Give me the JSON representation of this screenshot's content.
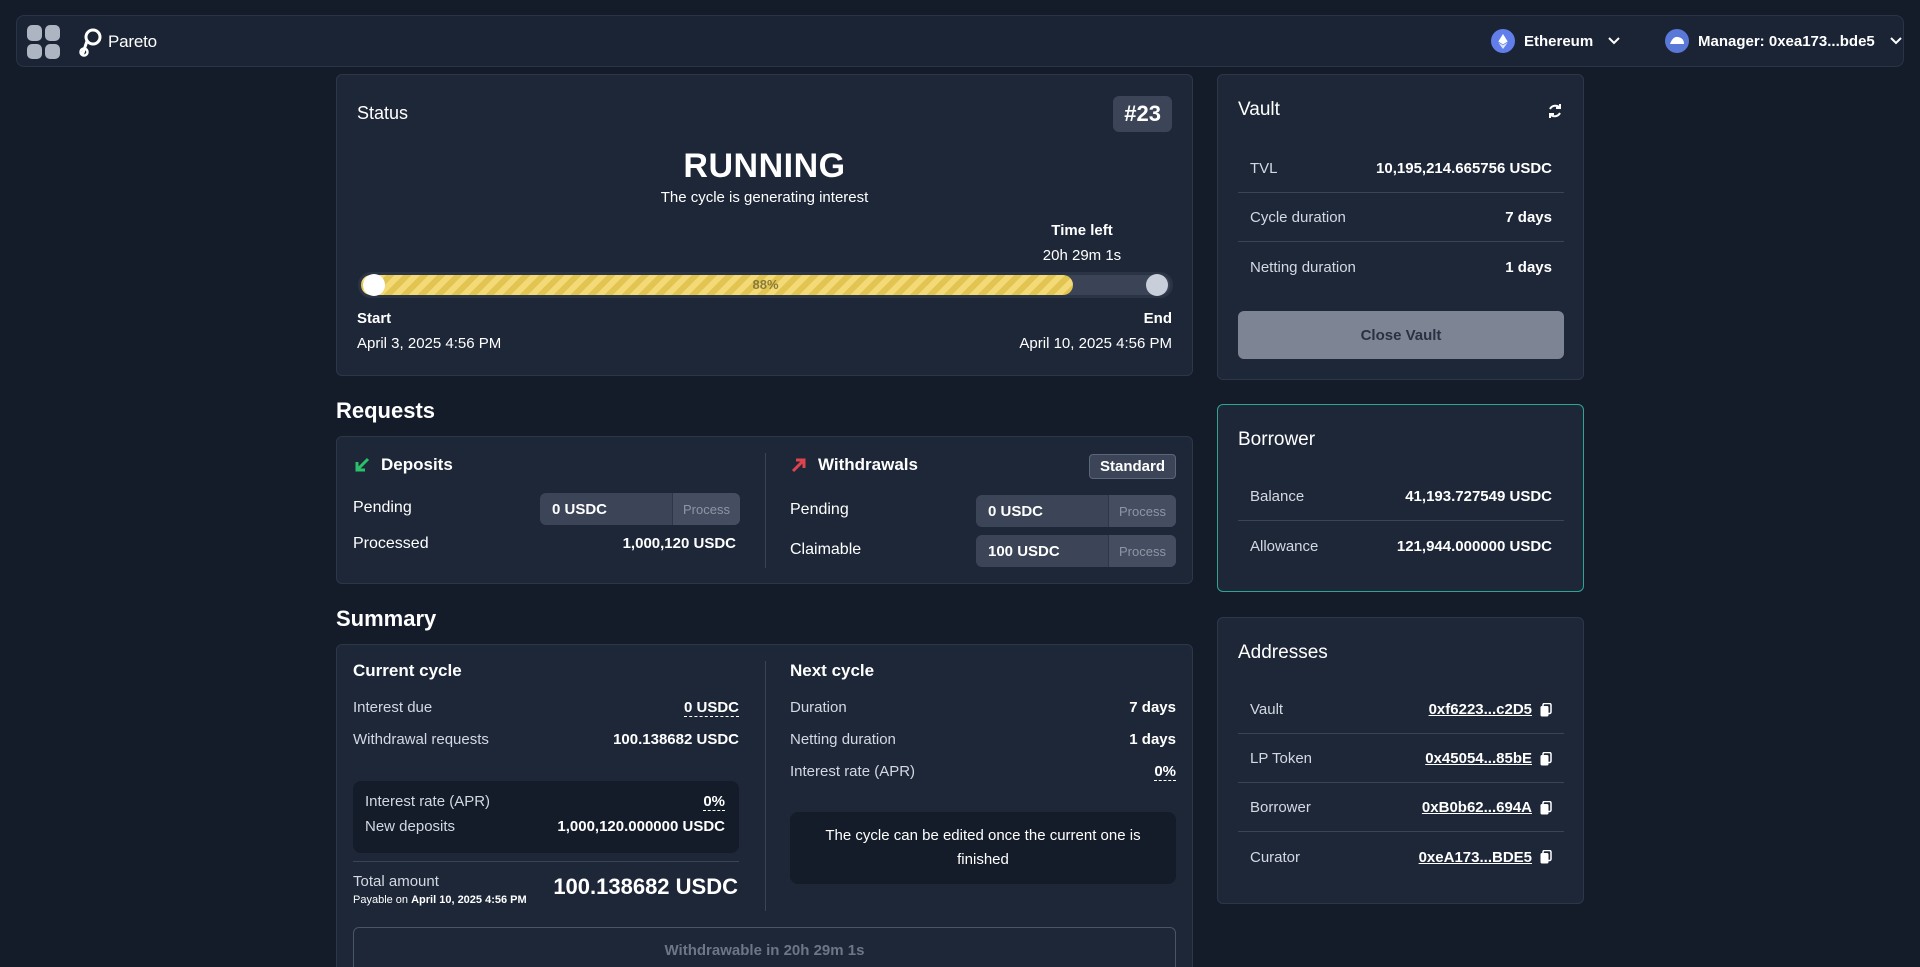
{
  "topbar": {
    "brand": "Pareto",
    "network": "Ethereum",
    "manager": "Manager: 0xea173...bde5"
  },
  "status": {
    "title": "Status",
    "cycle_number": "#23",
    "state": "RUNNING",
    "state_sub": "The cycle is generating interest",
    "time_left_label": "Time left",
    "time_left_value": "20h 29m 1s",
    "progress_percent": 88,
    "progress_label": "88%",
    "start_label": "Start",
    "start_value": "April 3, 2025 4:56 PM",
    "end_label": "End",
    "end_value": "April 10, 2025 4:56 PM"
  },
  "vault": {
    "title": "Vault",
    "rows": [
      {
        "label": "TVL",
        "value": "10,195,214.665756 USDC"
      },
      {
        "label": "Cycle duration",
        "value": "7 days"
      },
      {
        "label": "Netting duration",
        "value": "1 days"
      }
    ],
    "close_label": "Close Vault"
  },
  "borrower": {
    "title": "Borrower",
    "rows": [
      {
        "label": "Balance",
        "value": "41,193.727549 USDC"
      },
      {
        "label": "Allowance",
        "value": "121,944.000000 USDC"
      }
    ]
  },
  "addresses": {
    "title": "Addresses",
    "rows": [
      {
        "label": "Vault",
        "value": "0xf6223...c2D5"
      },
      {
        "label": "LP Token",
        "value": "0x45054...85bE"
      },
      {
        "label": "Borrower",
        "value": "0xB0b62...694A"
      },
      {
        "label": "Curator",
        "value": "0xeA173...BDE5"
      }
    ]
  },
  "requests": {
    "title": "Requests",
    "deposits": {
      "title": "Deposits",
      "pending_label": "Pending",
      "pending_value": "0 USDC",
      "process_label": "Process",
      "processed_label": "Processed",
      "processed_value": "1,000,120 USDC"
    },
    "withdrawals": {
      "title": "Withdrawals",
      "badge": "Standard",
      "pending_label": "Pending",
      "pending_value": "0 USDC",
      "claimable_label": "Claimable",
      "claimable_value": "100 USDC",
      "process_label": "Process"
    }
  },
  "summary": {
    "title": "Summary",
    "current": {
      "title": "Current cycle",
      "interest_due_label": "Interest due",
      "interest_due_value": "0 USDC",
      "withdrawal_label": "Withdrawal requests",
      "withdrawal_value": "100.138682 USDC",
      "apr_label": "Interest rate (APR)",
      "apr_value": "0%",
      "new_deposits_label": "New deposits",
      "new_deposits_value": "1,000,120.000000 USDC",
      "total_label": "Total amount",
      "payable_prefix": "Payable on",
      "payable_date": "April 10, 2025 4:56 PM",
      "total_value": "100.138682 USDC"
    },
    "next": {
      "title": "Next cycle",
      "duration_label": "Duration",
      "duration_value": "7 days",
      "netting_label": "Netting duration",
      "netting_value": "1 days",
      "apr_label": "Interest rate (APR)",
      "apr_value": "0%",
      "note": "The cycle can be edited once the current one is finished"
    },
    "withdraw_button": "Withdrawable in 20h 29m 1s"
  },
  "colors": {
    "background": "#141b29",
    "card": "#1e2738",
    "progress": "#f4da77",
    "deposit_icon": "#2bbf6a",
    "withdraw_icon": "#e0424e",
    "borrower_border": "#2fa58f"
  }
}
